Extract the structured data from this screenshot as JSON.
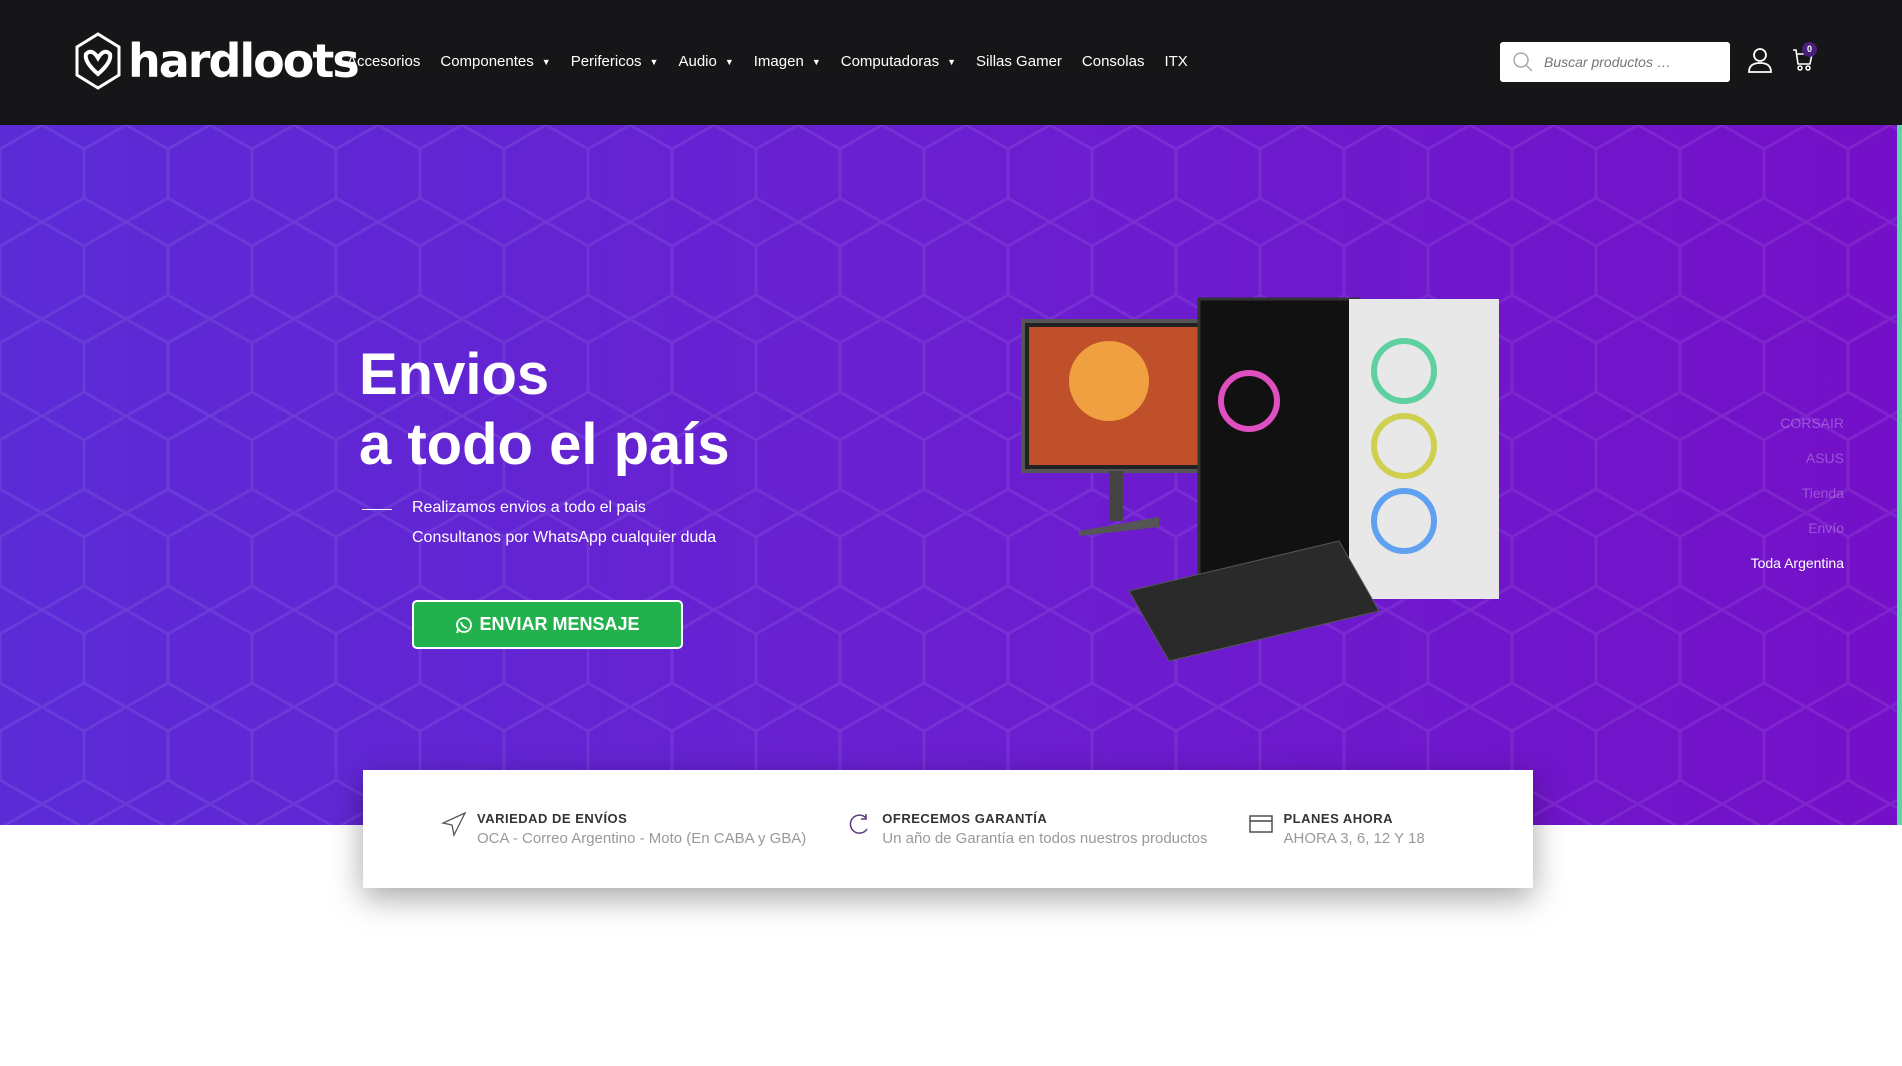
{
  "header": {
    "logo": "hardloots",
    "nav": [
      {
        "label": "Accesorios",
        "dropdown": false
      },
      {
        "label": "Componentes",
        "dropdown": true
      },
      {
        "label": "Perifericos",
        "dropdown": true
      },
      {
        "label": "Audio",
        "dropdown": true
      },
      {
        "label": "Imagen",
        "dropdown": true
      },
      {
        "label": "Computadoras",
        "dropdown": true
      },
      {
        "label": "Sillas Gamer",
        "dropdown": false
      },
      {
        "label": "Consolas",
        "dropdown": false
      },
      {
        "label": "ITX",
        "dropdown": false
      }
    ],
    "search_placeholder": "Buscar productos …",
    "cart_count": "0"
  },
  "hero": {
    "title_line1": "Envios",
    "title_line2": "a todo el país",
    "line1": "Realizamos envios a todo el pais",
    "line2": "Consultanos por WhatsApp cualquier duda",
    "button": "ENVIAR MENSAJE",
    "side_nav": [
      "CORSAIR",
      "ASUS",
      "Tienda",
      "Envío",
      "Toda Argentina"
    ]
  },
  "features": [
    {
      "title": "VARIEDAD DE ENVÍOS",
      "text": "OCA - Correo Argentino - Moto (En CABA y GBA)",
      "icon": "send-icon"
    },
    {
      "title": "OFRECEMOS GARANTÍA",
      "text": "Un año de Garantía en todos nuestros productos",
      "icon": "refresh-icon"
    },
    {
      "title": "PLANES AHORA",
      "text": "AHORA 3, 6, 12 Y 18",
      "icon": "credit-card-icon"
    }
  ],
  "colors": {
    "header": "#161618",
    "hero": "#6a1fd0",
    "button": "#23b14d"
  }
}
